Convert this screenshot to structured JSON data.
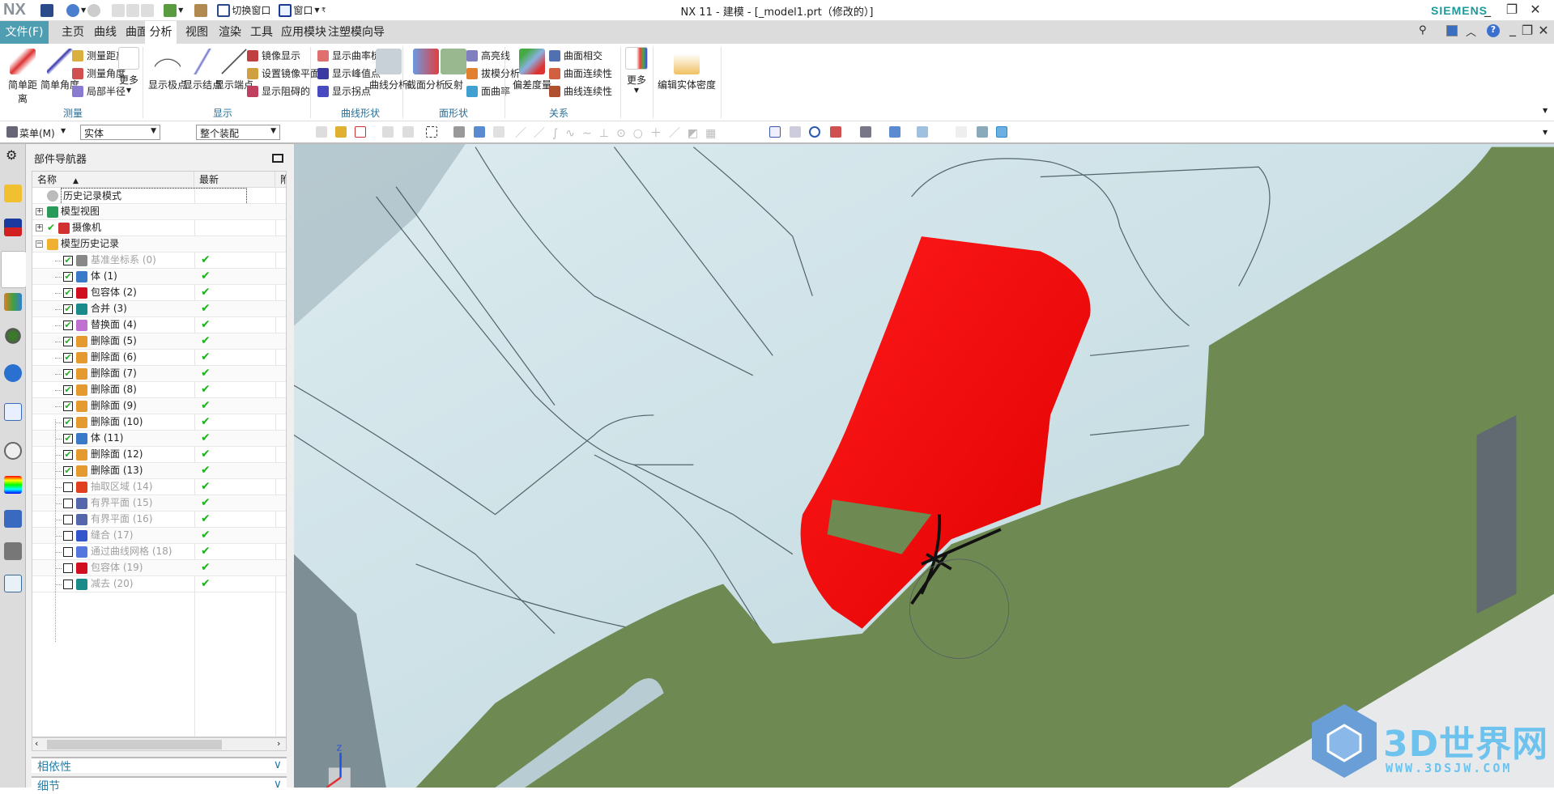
{
  "app": {
    "logo": "NX",
    "title": "NX 11 - 建模 - [_model1.prt（修改的）]",
    "brand": "SIEMENS"
  },
  "quick_access": {
    "switch_window": "切换窗口",
    "window": "窗口"
  },
  "tabs": [
    {
      "label": "文件(F)"
    },
    {
      "label": "主页"
    },
    {
      "label": "曲线"
    },
    {
      "label": "曲面"
    },
    {
      "label": "分析",
      "active": true
    },
    {
      "label": "视图"
    },
    {
      "label": "渲染"
    },
    {
      "label": "工具"
    },
    {
      "label": "应用模块"
    },
    {
      "label": "注塑模向导"
    }
  ],
  "search": {
    "placeholder": "查找命令"
  },
  "ribbon": {
    "measure": {
      "label": "测量",
      "simple_distance": "简单距离",
      "simple_angle": "简单角度",
      "measure_distance": "测量距离",
      "measure_angle": "测量角度",
      "local_radius": "局部半径",
      "more": "更多"
    },
    "display": {
      "label": "显示",
      "show_poles": "显示极点",
      "show_knots": "显示结点",
      "show_endpoints": "显示端点",
      "mirror_display": "镜像显示",
      "set_mirror_plane": "设置镜像平面...",
      "show_blocked": "显示阻碍的"
    },
    "curve_shape": {
      "label": "曲线形状",
      "curvature_comb": "显示曲率梳",
      "peak_points": "显示峰值点",
      "inflection": "显示拐点",
      "curve_analysis": "曲线分析"
    },
    "face_shape": {
      "label": "面形状",
      "section_analysis": "截面分析",
      "reflection": "反射",
      "highlight_lines": "高亮线",
      "draft_analysis": "拔模分析",
      "face_curvature": "面曲率"
    },
    "relation": {
      "label": "关系",
      "deviation": "偏差度量",
      "face_intersect": "曲面相交",
      "face_continuity": "曲面连续性",
      "curve_continuity": "曲线连续性"
    },
    "more": "更多",
    "edit_density": "编辑实体密度"
  },
  "toolbar": {
    "menu": "菜单(M)",
    "type_filter": "实体",
    "scope": "整个装配"
  },
  "navigator": {
    "title": "部件导航器",
    "columns": [
      "名称",
      "最新",
      "附"
    ],
    "rows": [
      {
        "name": "历史记录模式",
        "level": 0,
        "icon": "clock-icon"
      },
      {
        "name": "模型视图",
        "level": 0,
        "expand": "+",
        "icon": "model-views-icon"
      },
      {
        "name": "摄像机",
        "level": 0,
        "expand": "+",
        "check": true,
        "icon": "camera-icon"
      },
      {
        "name": "模型历史记录",
        "level": 0,
        "expand": "-",
        "icon": "folder-open-icon"
      },
      {
        "name": "基准坐标系 (0)",
        "checked": true,
        "gray": true,
        "ok": true,
        "color": "#888"
      },
      {
        "name": "体 (1)",
        "checked": true,
        "ok": true,
        "color": "#3a78c8"
      },
      {
        "name": "包容体 (2)",
        "checked": true,
        "ok": true,
        "color": "#d01020"
      },
      {
        "name": "合并 (3)",
        "checked": true,
        "ok": true,
        "color": "#1a8a8a"
      },
      {
        "name": "替换面 (4)",
        "checked": true,
        "ok": true,
        "color": "#c070d0"
      },
      {
        "name": "删除面 (5)",
        "checked": true,
        "ok": true,
        "color": "#e59a30"
      },
      {
        "name": "删除面 (6)",
        "checked": true,
        "ok": true,
        "color": "#e59a30"
      },
      {
        "name": "删除面 (7)",
        "checked": true,
        "ok": true,
        "color": "#e59a30"
      },
      {
        "name": "删除面 (8)",
        "checked": true,
        "ok": true,
        "color": "#e59a30"
      },
      {
        "name": "删除面 (9)",
        "checked": true,
        "ok": true,
        "color": "#e59a30"
      },
      {
        "name": "删除面 (10)",
        "checked": true,
        "ok": true,
        "color": "#e59a30"
      },
      {
        "name": "体 (11)",
        "checked": true,
        "ok": true,
        "color": "#3a78c8"
      },
      {
        "name": "删除面 (12)",
        "checked": true,
        "ok": true,
        "color": "#e59a30"
      },
      {
        "name": "删除面 (13)",
        "checked": true,
        "ok": true,
        "color": "#e59a30"
      },
      {
        "name": "抽取区域 (14)",
        "checked": false,
        "gray": true,
        "ok": true,
        "color": "#e04020"
      },
      {
        "name": "有界平面 (15)",
        "checked": false,
        "gray": true,
        "ok": true,
        "color": "#5566aa"
      },
      {
        "name": "有界平面 (16)",
        "checked": false,
        "gray": true,
        "ok": true,
        "color": "#5566aa"
      },
      {
        "name": "缝合 (17)",
        "checked": false,
        "gray": true,
        "ok": true,
        "color": "#3355cc"
      },
      {
        "name": "通过曲线网格 (18)",
        "checked": false,
        "gray": true,
        "ok": true,
        "color": "#5577dd"
      },
      {
        "name": "包容体 (19)",
        "checked": false,
        "gray": true,
        "ok": true,
        "color": "#d01020"
      },
      {
        "name": "减去 (20)",
        "checked": false,
        "gray": true,
        "ok": true,
        "color": "#1a8a8a"
      }
    ],
    "panels": [
      "相依性",
      "细节"
    ]
  },
  "viewport": {
    "colors": {
      "body": "#cbe2e8",
      "plate": "#6e8a52",
      "highlight": "#ff0000",
      "background": "#e8e9eb"
    }
  },
  "watermark": {
    "text": "3D世界网",
    "url": "WWW.3DSJW.COM"
  }
}
